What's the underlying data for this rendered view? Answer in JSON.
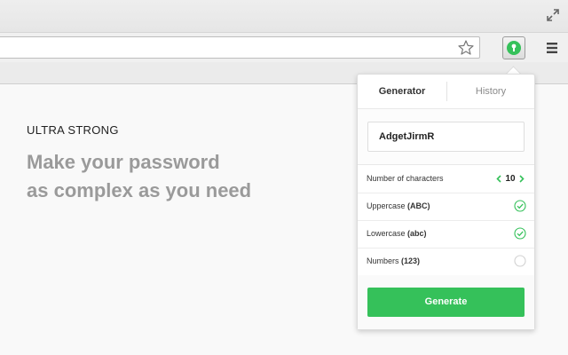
{
  "browser": {
    "expand_icon": "expand-arrows-icon",
    "bookmark_icon": "star-outline-icon",
    "extension_icon": "keyhole-icon",
    "menu_icon": "hamburger-menu-icon"
  },
  "page": {
    "eyebrow": "ULTRA STRONG",
    "headline_line1": "Make your password",
    "headline_line2": "as complex as you need"
  },
  "popup": {
    "tabs": [
      {
        "label": "Generator",
        "active": true
      },
      {
        "label": "History",
        "active": false
      }
    ],
    "password_value": "AdgetJirmR",
    "length": {
      "label": "Number of characters",
      "value": "10"
    },
    "options": [
      {
        "label": "Uppercase",
        "hint": "(ABC)",
        "checked": true
      },
      {
        "label": "Lowercase",
        "hint": "(abc)",
        "checked": true
      },
      {
        "label": "Numbers",
        "hint": "(123)",
        "checked": false
      }
    ],
    "generate_label": "Generate"
  },
  "colors": {
    "accent_green": "#35c15a",
    "check_green": "#35c15a",
    "headline_gray": "#9a9a9a"
  }
}
